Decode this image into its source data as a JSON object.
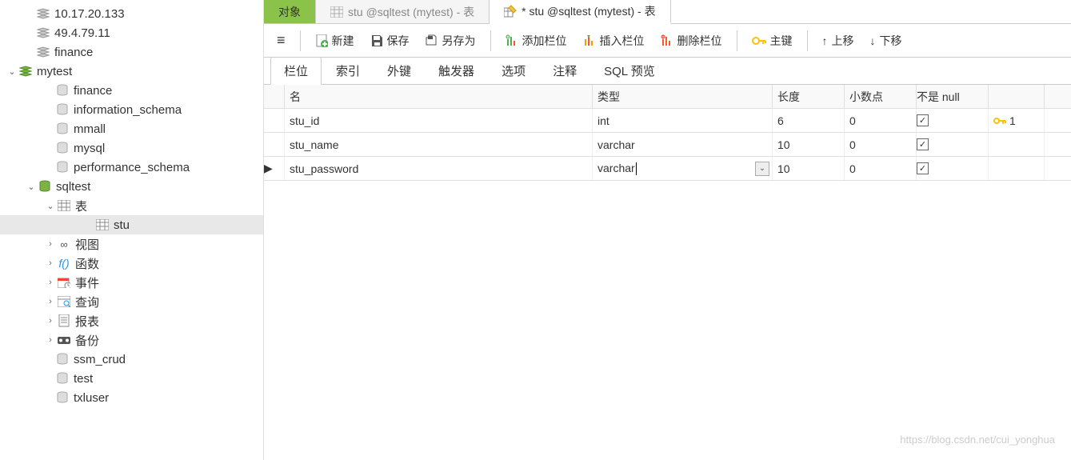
{
  "sidebar": {
    "nodes": [
      {
        "indent": 30,
        "chev": "",
        "icon": "conn",
        "label": "10.17.20.133"
      },
      {
        "indent": 30,
        "chev": "",
        "icon": "conn",
        "label": "49.4.79.11"
      },
      {
        "indent": 30,
        "chev": "",
        "icon": "conn",
        "label": "finance"
      },
      {
        "indent": 8,
        "chev": "v",
        "icon": "conn-green",
        "label": "mytest"
      },
      {
        "indent": 54,
        "chev": "",
        "icon": "db",
        "label": "finance"
      },
      {
        "indent": 54,
        "chev": "",
        "icon": "db",
        "label": "information_schema"
      },
      {
        "indent": 54,
        "chev": "",
        "icon": "db",
        "label": "mmall"
      },
      {
        "indent": 54,
        "chev": "",
        "icon": "db",
        "label": "mysql"
      },
      {
        "indent": 54,
        "chev": "",
        "icon": "db",
        "label": "performance_schema"
      },
      {
        "indent": 32,
        "chev": "v",
        "icon": "db-green",
        "label": "sqltest"
      },
      {
        "indent": 56,
        "chev": "v",
        "icon": "tables",
        "label": "表"
      },
      {
        "indent": 104,
        "chev": "",
        "icon": "table",
        "label": "stu",
        "sel": true
      },
      {
        "indent": 56,
        "chev": ">",
        "icon": "view",
        "label": "视图"
      },
      {
        "indent": 56,
        "chev": ">",
        "icon": "func",
        "label": "函数"
      },
      {
        "indent": 56,
        "chev": ">",
        "icon": "event",
        "label": "事件"
      },
      {
        "indent": 56,
        "chev": ">",
        "icon": "query",
        "label": "查询"
      },
      {
        "indent": 56,
        "chev": ">",
        "icon": "report",
        "label": "报表"
      },
      {
        "indent": 56,
        "chev": ">",
        "icon": "backup",
        "label": "备份"
      },
      {
        "indent": 54,
        "chev": "",
        "icon": "db",
        "label": "ssm_crud"
      },
      {
        "indent": 54,
        "chev": "",
        "icon": "db",
        "label": "test"
      },
      {
        "indent": 54,
        "chev": "",
        "icon": "db",
        "label": "txluser"
      }
    ]
  },
  "tabs": {
    "obj": "对象",
    "inactive": "stu @sqltest (mytest) - 表",
    "active": "* stu @sqltest (mytest) - 表"
  },
  "toolbar": {
    "new": "新建",
    "save": "保存",
    "saveas": "另存为",
    "addcol": "添加栏位",
    "inscol": "插入栏位",
    "delcol": "删除栏位",
    "pk": "主键",
    "up": "上移",
    "down": "下移"
  },
  "subtabs": [
    "栏位",
    "索引",
    "外键",
    "触发器",
    "选项",
    "注释",
    "SQL 预览"
  ],
  "grid": {
    "headers": {
      "name": "名",
      "type": "类型",
      "len": "长度",
      "dec": "小数点",
      "null": "不是 null",
      "key": ""
    },
    "rows": [
      {
        "marker": "",
        "name": "stu_id",
        "type": "int",
        "len": "6",
        "dec": "0",
        "null": true,
        "key": "1",
        "dd": false
      },
      {
        "marker": "",
        "name": "stu_name",
        "type": "varchar",
        "len": "10",
        "dec": "0",
        "null": true,
        "key": "",
        "dd": false
      },
      {
        "marker": "▶",
        "name": "stu_password",
        "type": "varchar",
        "len": "10",
        "dec": "0",
        "null": true,
        "key": "",
        "dd": true,
        "cursor": true
      }
    ]
  },
  "watermark": "https://blog.csdn.net/cui_yonghua"
}
